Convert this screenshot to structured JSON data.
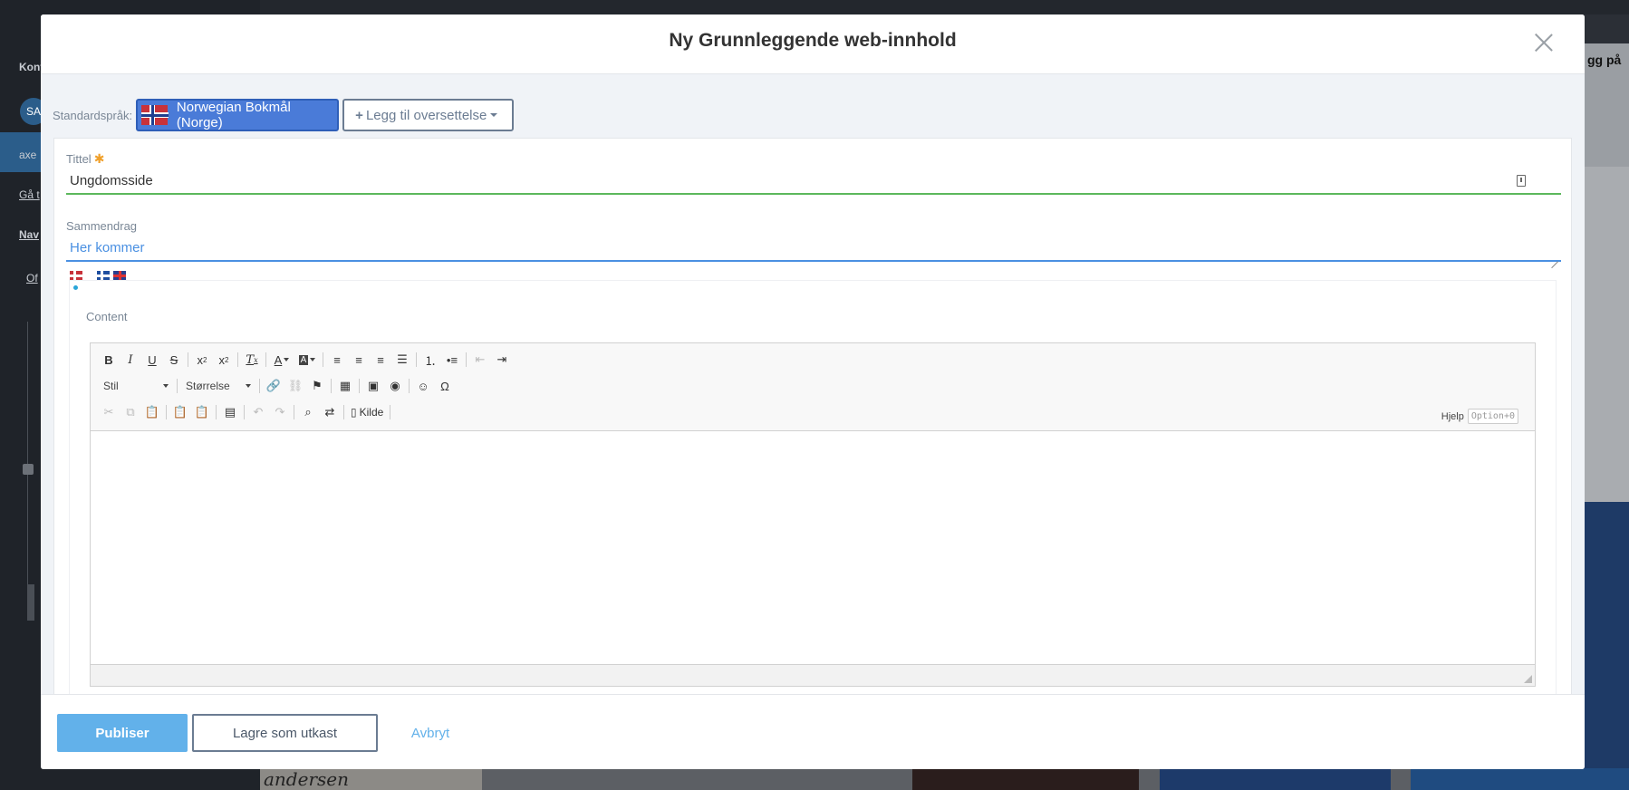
{
  "background": {
    "sidebar_texts": [
      "Kont",
      "SA",
      "axe",
      "Gå t",
      "Nav",
      "Of"
    ],
    "right_text": "gg på",
    "bottom_script_text": "andersen"
  },
  "modal": {
    "title": "Ny Grunnleggende web-innhold",
    "language_bar": {
      "label": "Standardspråk:",
      "default_language": "Norwegian Bokmål (Norge)",
      "add_translation": "Legg til oversettelse"
    },
    "title_field": {
      "label": "Tittel",
      "required_mark": "✱",
      "value": "Ungdomsside"
    },
    "summary_field": {
      "label": "Sammendrag",
      "value": "Her kommer"
    },
    "content": {
      "label": "Content",
      "toolbar": {
        "style_combo": "Stil",
        "size_combo": "Størrelse",
        "source_button": "Kilde",
        "help_label": "Hjelp",
        "help_shortcut": "Option+0"
      }
    },
    "footer": {
      "publish": "Publiser",
      "save_draft": "Lagre som utkast",
      "cancel": "Avbryt"
    }
  },
  "colors": {
    "primary_button": "#62b1ea",
    "language_button": "#4a7bd8",
    "title_underline": "#5cb85c",
    "summary_underline": "#4a90e2",
    "required_star": "#f0a02a"
  }
}
